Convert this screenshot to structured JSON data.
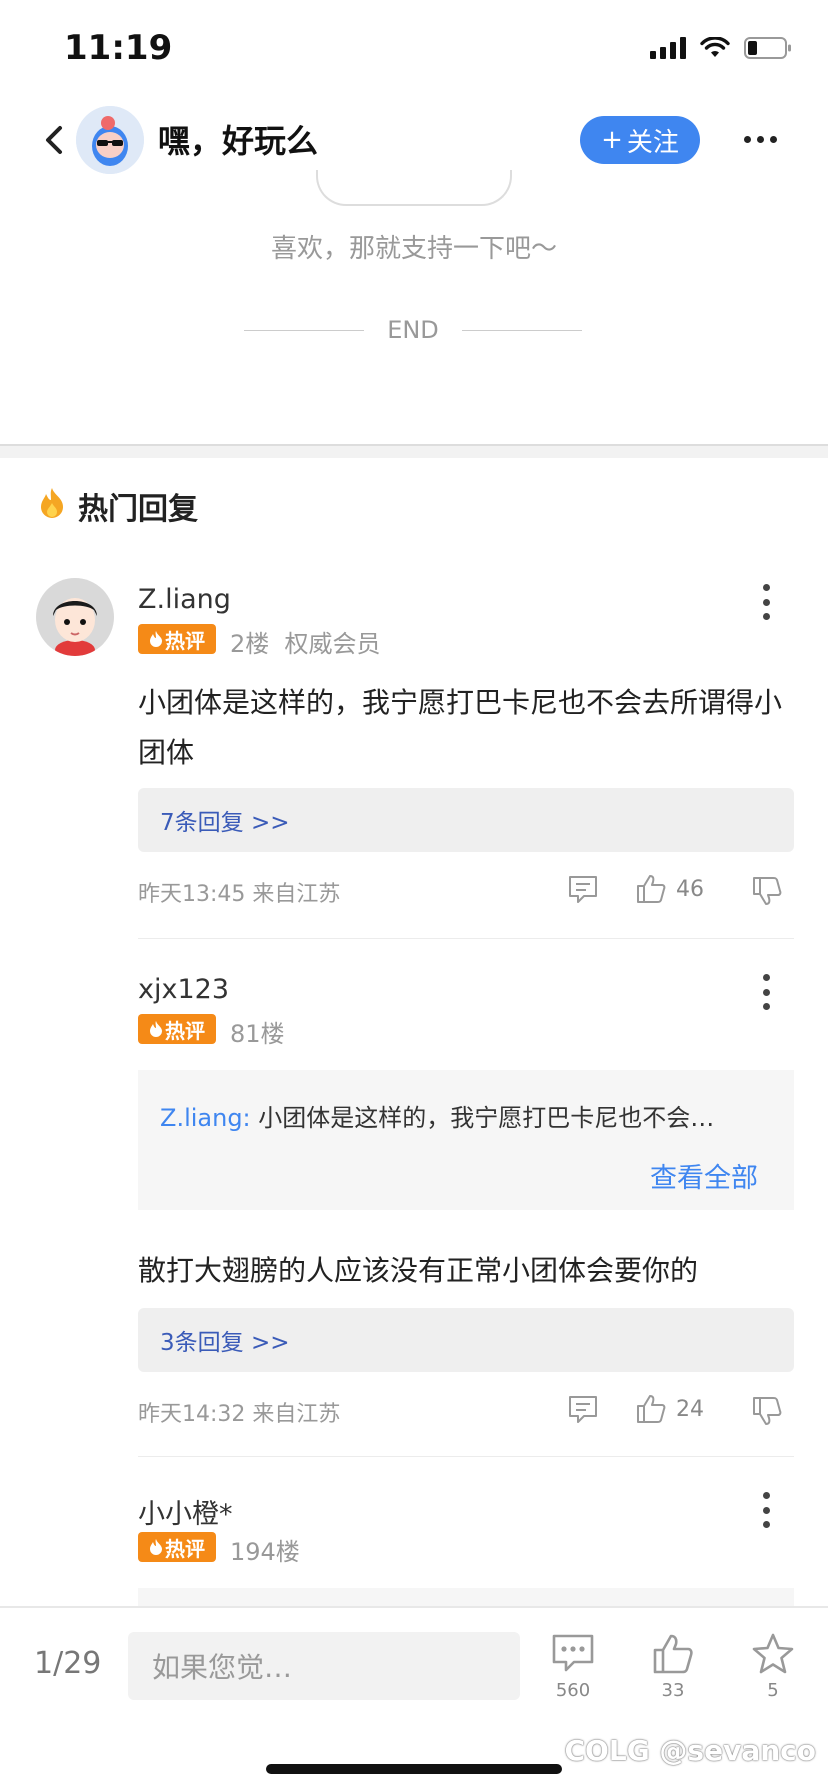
{
  "status_bar": {
    "time": "11:19"
  },
  "nav": {
    "title": "嘿，好玩么",
    "follow_label": "关注",
    "follow_plus": "+"
  },
  "article_end": {
    "support_text": "喜欢，那就支持一下吧～",
    "end_label": "END"
  },
  "hot_replies": {
    "title": "热门回复",
    "badge_label": "热评",
    "comments": [
      {
        "username": "Z.liang",
        "floor": "2楼",
        "member": "权威会员",
        "text": "小团体是这样的，我宁愿打巴卡尼也不会去所谓得小团体",
        "replies_label": "7条回复 >>",
        "meta": "昨天13:45 来自江苏",
        "likes": "46"
      },
      {
        "username": "xjx123",
        "floor": "81楼",
        "quote_name": "Z.liang:",
        "quote_text": "小团体是这样的，我宁愿打巴卡尼也不会…",
        "view_all": "查看全部",
        "text": "散打大翅膀的人应该没有正常小团体会要你的",
        "replies_label": "3条回复 >>",
        "meta": "昨天14:32 来自江苏",
        "likes": "24"
      },
      {
        "username": "小小橙*",
        "floor": "194楼"
      }
    ]
  },
  "bottom_bar": {
    "page_indicator": "1/29",
    "input_placeholder": "如果您觉…",
    "comment_count": "560",
    "like_count": "33",
    "favorite_count": "5"
  },
  "watermark": "COLG @sevanco",
  "colors": {
    "accent": "#3f86f0",
    "hot_badge": "#f58a17"
  }
}
